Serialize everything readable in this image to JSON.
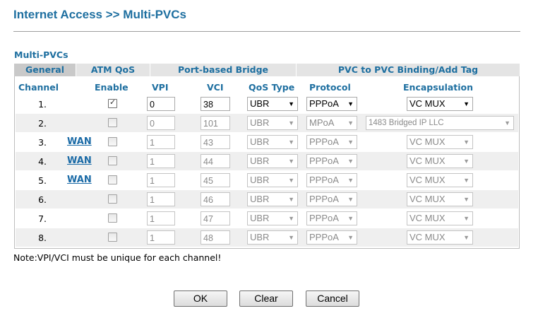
{
  "header": {
    "title": "Internet Access >> Multi-PVCs"
  },
  "section_title": "Multi-PVCs",
  "tabs": [
    {
      "label": "General",
      "active": true
    },
    {
      "label": "ATM QoS",
      "active": false
    },
    {
      "label": "Port-based Bridge",
      "active": false
    },
    {
      "label": "PVC to PVC Binding/Add Tag",
      "active": false
    }
  ],
  "columns": {
    "channel": "Channel",
    "enable": "Enable",
    "vpi": "VPI",
    "vci": "VCI",
    "qos": "QoS Type",
    "protocol": "Protocol",
    "encap": "Encapsulation"
  },
  "rows": [
    {
      "channel": "1.",
      "wan": "",
      "enabled": true,
      "vpi": "0",
      "vci": "38",
      "qos": "UBR",
      "protocol": "PPPoA",
      "encap": "VC MUX",
      "disabled": false
    },
    {
      "channel": "2.",
      "wan": "",
      "enabled": false,
      "vpi": "0",
      "vci": "101",
      "qos": "UBR",
      "protocol": "MPoA",
      "encap": "1483 Bridged IP LLC",
      "disabled": true
    },
    {
      "channel": "3.",
      "wan": "WAN",
      "enabled": false,
      "vpi": "1",
      "vci": "43",
      "qos": "UBR",
      "protocol": "PPPoA",
      "encap": "VC MUX",
      "disabled": true
    },
    {
      "channel": "4.",
      "wan": "WAN",
      "enabled": false,
      "vpi": "1",
      "vci": "44",
      "qos": "UBR",
      "protocol": "PPPoA",
      "encap": "VC MUX",
      "disabled": true
    },
    {
      "channel": "5.",
      "wan": "WAN",
      "enabled": false,
      "vpi": "1",
      "vci": "45",
      "qos": "UBR",
      "protocol": "PPPoA",
      "encap": "VC MUX",
      "disabled": true
    },
    {
      "channel": "6.",
      "wan": "",
      "enabled": false,
      "vpi": "1",
      "vci": "46",
      "qos": "UBR",
      "protocol": "PPPoA",
      "encap": "VC MUX",
      "disabled": true
    },
    {
      "channel": "7.",
      "wan": "",
      "enabled": false,
      "vpi": "1",
      "vci": "47",
      "qos": "UBR",
      "protocol": "PPPoA",
      "encap": "VC MUX",
      "disabled": true
    },
    {
      "channel": "8.",
      "wan": "",
      "enabled": false,
      "vpi": "1",
      "vci": "48",
      "qos": "UBR",
      "protocol": "PPPoA",
      "encap": "VC MUX",
      "disabled": true
    }
  ],
  "note": "Note:VPI/VCI must be unique for each channel!",
  "buttons": {
    "ok": "OK",
    "clear": "Clear",
    "cancel": "Cancel"
  },
  "colors": {
    "accent": "#1e6fa0",
    "link": "#1a6aa6",
    "row_shade": "#efefef",
    "tab_active": "#c9c9c9",
    "tab_inactive": "#e4e4e4"
  }
}
